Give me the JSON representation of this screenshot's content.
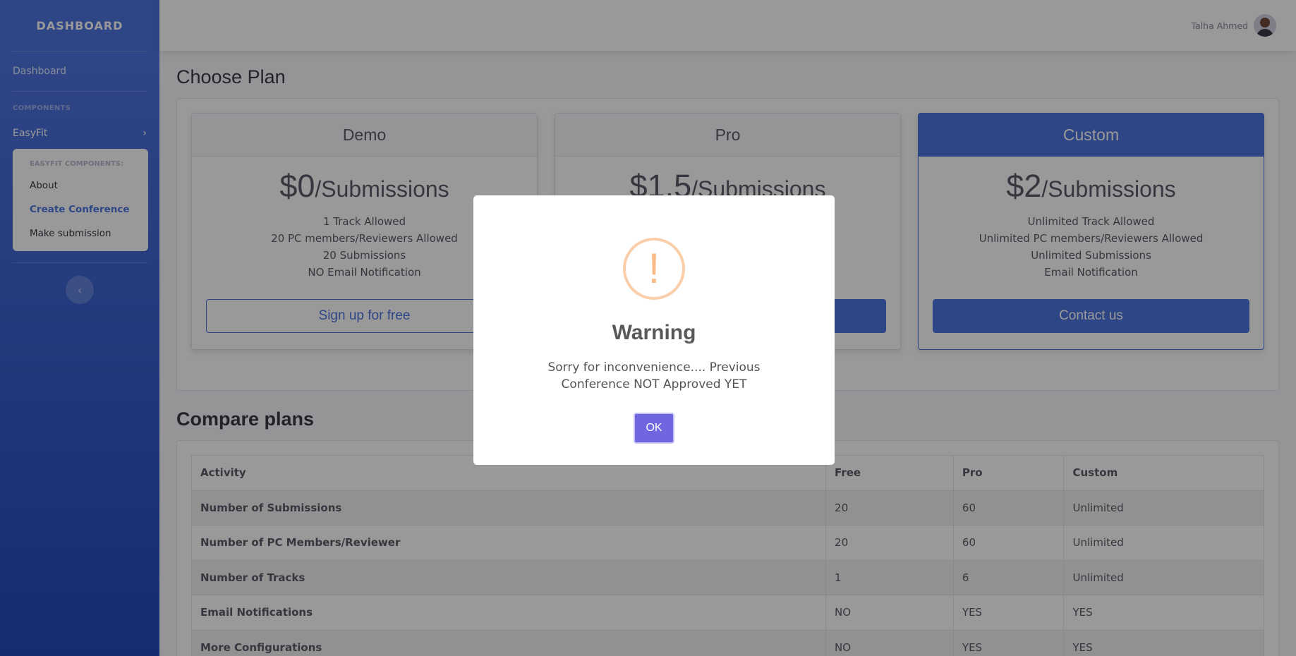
{
  "sidebar": {
    "brand": "DASHBOARD",
    "dashboard_label": "Dashboard",
    "components_heading": "COMPONENTS",
    "easyfit_label": "EasyFit",
    "collapse_header": "EASYFIT COMPONENTS:",
    "items": [
      {
        "label": "About",
        "active": false
      },
      {
        "label": "Create Conference",
        "active": true
      },
      {
        "label": "Make submission",
        "active": false
      }
    ]
  },
  "topbar": {
    "username": "Talha Ahmed"
  },
  "main": {
    "title": "Choose Plan",
    "plans": [
      {
        "name": "Demo",
        "price": "$0",
        "unit": "/Submissions",
        "features": [
          "1 Track Allowed",
          "20 PC members/Reviewers Allowed",
          "20 Submissions",
          "NO Email Notification"
        ],
        "button": "Sign up for free"
      },
      {
        "name": "Pro",
        "price": "$1.5",
        "unit": "/Submissions",
        "features": [
          "",
          "",
          "",
          ""
        ],
        "button": ""
      },
      {
        "name": "Custom",
        "price": "$2",
        "unit": "/Submissions",
        "features": [
          "Unlimited Track Allowed",
          "Unlimited PC members/Reviewers Allowed",
          "Unlimited Submissions",
          "Email Notification"
        ],
        "button": "Contact us"
      }
    ],
    "compare_title": "Compare plans",
    "table": {
      "headers": [
        "Activity",
        "Free",
        "Pro",
        "Custom"
      ],
      "rows": [
        [
          "Number of Submissions",
          "20",
          "60",
          "Unlimited"
        ],
        [
          "Number of PC Members/Reviewer",
          "20",
          "60",
          "Unlimited"
        ],
        [
          "Number of Tracks",
          "1",
          "6",
          "Unlimited"
        ],
        [
          "Email Notifications",
          "NO",
          "YES",
          "YES"
        ],
        [
          "More Configurations",
          "NO",
          "YES",
          "YES"
        ]
      ]
    }
  },
  "modal": {
    "icon": "exclamation-icon",
    "icon_symbol": "!",
    "title": "Warning",
    "text": "Sorry for inconvenience.... Previous Conference NOT Approved YET",
    "ok_label": "OK"
  },
  "colors": {
    "primary": "#4e73df",
    "confirm": "#7066e0",
    "warning": "#f8bb86"
  }
}
